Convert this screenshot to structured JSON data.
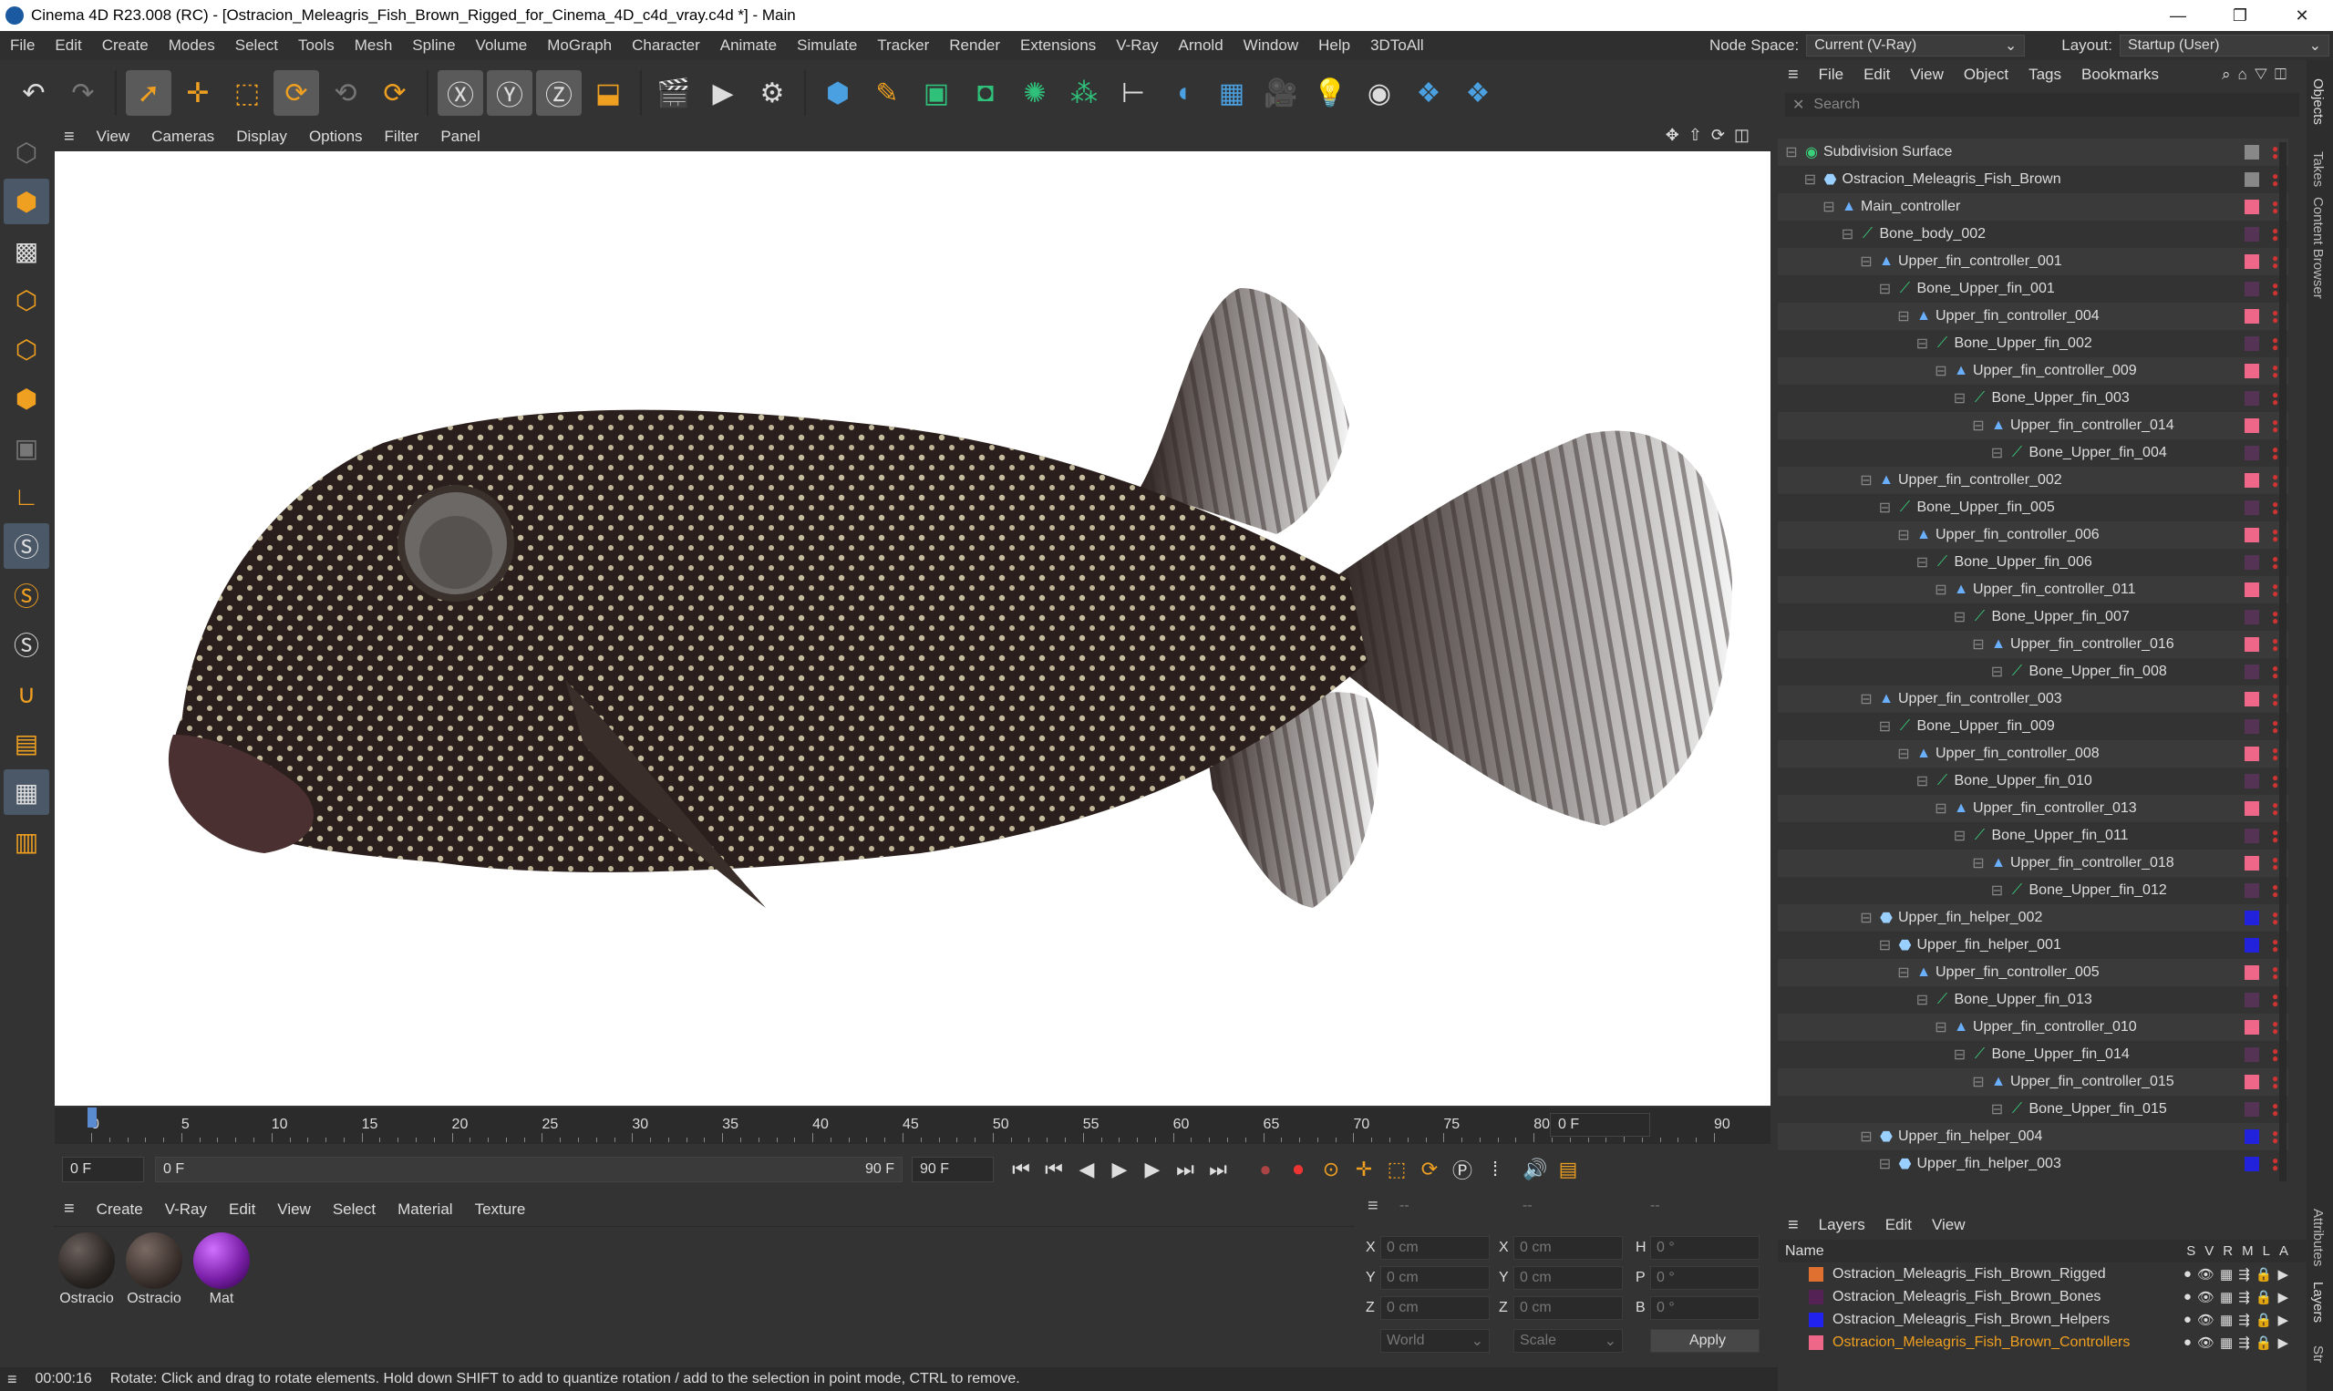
{
  "window": {
    "title": "Cinema 4D R23.008 (RC) - [Ostracion_Meleagris_Fish_Brown_Rigged_for_Cinema_4D_c4d_vray.c4d *] - Main",
    "min": "—",
    "max": "❐",
    "close": "✕"
  },
  "menubar": {
    "items": [
      "File",
      "Edit",
      "Create",
      "Modes",
      "Select",
      "Tools",
      "Mesh",
      "Spline",
      "Volume",
      "MoGraph",
      "Character",
      "Animate",
      "Simulate",
      "Tracker",
      "Render",
      "Extensions",
      "V-Ray",
      "Arnold",
      "Window",
      "Help",
      "3DToAll"
    ],
    "node_space_label": "Node Space:",
    "node_space_value": "Current (V-Ray)",
    "layout_label": "Layout:",
    "layout_value": "Startup (User)"
  },
  "viewport": {
    "menu": [
      "View",
      "Cameras",
      "Display",
      "Options",
      "Filter",
      "Panel"
    ]
  },
  "timeline": {
    "ticks": [
      "0",
      "5",
      "10",
      "15",
      "20",
      "25",
      "30",
      "35",
      "40",
      "45",
      "50",
      "55",
      "60",
      "65",
      "70",
      "75",
      "80",
      "85",
      "90"
    ],
    "current_frame": "0 F",
    "start_field": "0 F",
    "range_start": "0 F",
    "range_end": "90 F",
    "end_field": "90 F"
  },
  "materials": {
    "menu": [
      "Create",
      "V-Ray",
      "Edit",
      "View",
      "Select",
      "Material",
      "Texture"
    ],
    "items": [
      {
        "label": "Ostracio",
        "color": "#2a2522"
      },
      {
        "label": "Ostracio",
        "color": "#3a302c"
      },
      {
        "label": "Mat",
        "color": "#7a1fa8"
      }
    ]
  },
  "coordinates": {
    "x_pos": "0 cm",
    "y_pos": "0 cm",
    "z_pos": "0 cm",
    "x_size": "0 cm",
    "y_size": "0 cm",
    "z_size": "0 cm",
    "h": "0 °",
    "p": "0 °",
    "b": "0 °",
    "labels": {
      "x": "X",
      "y": "Y",
      "z": "Z",
      "h": "H",
      "p": "P",
      "b": "B"
    },
    "world": "World",
    "scale": "Scale",
    "apply": "Apply",
    "header": [
      "--",
      "--",
      "--"
    ]
  },
  "status": {
    "time": "00:00:16",
    "message": "Rotate: Click and drag to rotate elements. Hold down SHIFT to add to quantize rotation / add to the selection in point mode, CTRL to remove."
  },
  "objects": {
    "menu": [
      "File",
      "Edit",
      "View",
      "Object",
      "Tags",
      "Bookmarks"
    ],
    "search_placeholder": "Search",
    "rows": [
      {
        "name": "Subdivision Surface",
        "depth": 0,
        "icon": "subdiv-icon",
        "tag": "#888888"
      },
      {
        "name": "Ostracion_Meleagris_Fish_Brown",
        "depth": 1,
        "icon": "null-icon",
        "tag": "#888888"
      },
      {
        "name": "Main_controller",
        "depth": 2,
        "icon": "controller-icon",
        "tag": "#ee6688"
      },
      {
        "name": "Bone_body_002",
        "depth": 3,
        "icon": "bone-icon",
        "tag": "#553355"
      },
      {
        "name": "Upper_fin_controller_001",
        "depth": 4,
        "icon": "controller-icon",
        "tag": "#ee6688"
      },
      {
        "name": "Bone_Upper_fin_001",
        "depth": 5,
        "icon": "bone-icon",
        "tag": "#553355"
      },
      {
        "name": "Upper_fin_controller_004",
        "depth": 6,
        "icon": "controller-icon",
        "tag": "#ee6688"
      },
      {
        "name": "Bone_Upper_fin_002",
        "depth": 7,
        "icon": "bone-icon",
        "tag": "#553355"
      },
      {
        "name": "Upper_fin_controller_009",
        "depth": 8,
        "icon": "controller-icon",
        "tag": "#ee6688"
      },
      {
        "name": "Bone_Upper_fin_003",
        "depth": 9,
        "icon": "bone-icon",
        "tag": "#553355"
      },
      {
        "name": "Upper_fin_controller_014",
        "depth": 10,
        "icon": "controller-icon",
        "tag": "#ee6688"
      },
      {
        "name": "Bone_Upper_fin_004",
        "depth": 11,
        "icon": "bone-icon",
        "tag": "#553355"
      },
      {
        "name": "Upper_fin_controller_002",
        "depth": 4,
        "icon": "controller-icon",
        "tag": "#ee6688"
      },
      {
        "name": "Bone_Upper_fin_005",
        "depth": 5,
        "icon": "bone-icon",
        "tag": "#553355"
      },
      {
        "name": "Upper_fin_controller_006",
        "depth": 6,
        "icon": "controller-icon",
        "tag": "#ee6688"
      },
      {
        "name": "Bone_Upper_fin_006",
        "depth": 7,
        "icon": "bone-icon",
        "tag": "#553355"
      },
      {
        "name": "Upper_fin_controller_011",
        "depth": 8,
        "icon": "controller-icon",
        "tag": "#ee6688"
      },
      {
        "name": "Bone_Upper_fin_007",
        "depth": 9,
        "icon": "bone-icon",
        "tag": "#553355"
      },
      {
        "name": "Upper_fin_controller_016",
        "depth": 10,
        "icon": "controller-icon",
        "tag": "#ee6688"
      },
      {
        "name": "Bone_Upper_fin_008",
        "depth": 11,
        "icon": "bone-icon",
        "tag": "#553355"
      },
      {
        "name": "Upper_fin_controller_003",
        "depth": 4,
        "icon": "controller-icon",
        "tag": "#ee6688"
      },
      {
        "name": "Bone_Upper_fin_009",
        "depth": 5,
        "icon": "bone-icon",
        "tag": "#553355"
      },
      {
        "name": "Upper_fin_controller_008",
        "depth": 6,
        "icon": "controller-icon",
        "tag": "#ee6688"
      },
      {
        "name": "Bone_Upper_fin_010",
        "depth": 7,
        "icon": "bone-icon",
        "tag": "#553355"
      },
      {
        "name": "Upper_fin_controller_013",
        "depth": 8,
        "icon": "controller-icon",
        "tag": "#ee6688"
      },
      {
        "name": "Bone_Upper_fin_011",
        "depth": 9,
        "icon": "bone-icon",
        "tag": "#553355"
      },
      {
        "name": "Upper_fin_controller_018",
        "depth": 10,
        "icon": "controller-icon",
        "tag": "#ee6688"
      },
      {
        "name": "Bone_Upper_fin_012",
        "depth": 11,
        "icon": "bone-icon",
        "tag": "#553355"
      },
      {
        "name": "Upper_fin_helper_002",
        "depth": 4,
        "icon": "helper-icon",
        "tag": "#2222dd"
      },
      {
        "name": "Upper_fin_helper_001",
        "depth": 5,
        "icon": "helper-icon",
        "tag": "#2222dd"
      },
      {
        "name": "Upper_fin_controller_005",
        "depth": 6,
        "icon": "controller-icon",
        "tag": "#ee6688"
      },
      {
        "name": "Bone_Upper_fin_013",
        "depth": 7,
        "icon": "bone-icon",
        "tag": "#553355"
      },
      {
        "name": "Upper_fin_controller_010",
        "depth": 8,
        "icon": "controller-icon",
        "tag": "#ee6688"
      },
      {
        "name": "Bone_Upper_fin_014",
        "depth": 9,
        "icon": "bone-icon",
        "tag": "#553355"
      },
      {
        "name": "Upper_fin_controller_015",
        "depth": 10,
        "icon": "controller-icon",
        "tag": "#ee6688"
      },
      {
        "name": "Bone_Upper_fin_015",
        "depth": 11,
        "icon": "bone-icon",
        "tag": "#553355"
      },
      {
        "name": "Upper_fin_helper_004",
        "depth": 4,
        "icon": "helper-icon",
        "tag": "#2222dd"
      },
      {
        "name": "Upper_fin_helper_003",
        "depth": 5,
        "icon": "helper-icon",
        "tag": "#2222dd"
      }
    ]
  },
  "layers": {
    "menu": [
      "Layers",
      "Edit",
      "View"
    ],
    "header": {
      "name": "Name",
      "s": "S",
      "v": "V",
      "r": "R",
      "m": "M",
      "l": "L",
      "a": "A"
    },
    "rows": [
      {
        "name": "Ostracion_Meleagris_Fish_Brown_Rigged",
        "color": "#e07030",
        "highlight": false
      },
      {
        "name": "Ostracion_Meleagris_Fish_Brown_Bones",
        "color": "#552255",
        "highlight": false
      },
      {
        "name": "Ostracion_Meleagris_Fish_Brown_Helpers",
        "color": "#2222ee",
        "highlight": false
      },
      {
        "name": "Ostracion_Meleagris_Fish_Brown_Controllers",
        "color": "#ee6688",
        "highlight": true
      }
    ]
  },
  "side_tabs": [
    "Objects",
    "Takes",
    "Content Browser",
    "Attributes",
    "Layers",
    "Str"
  ]
}
